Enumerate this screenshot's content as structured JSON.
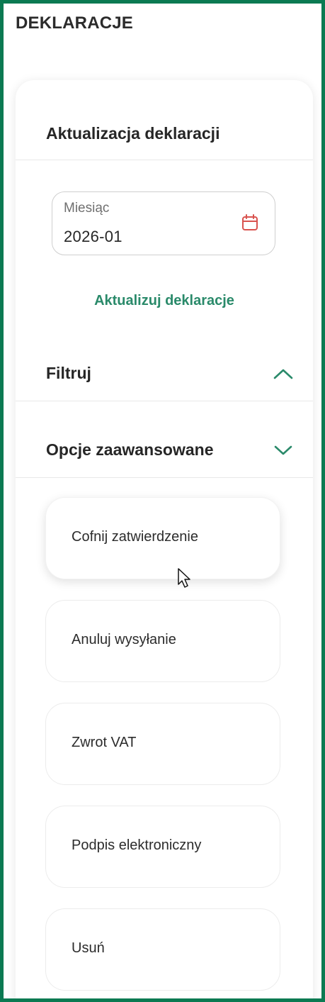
{
  "page": {
    "title": "DEKLARACJE"
  },
  "panel": {
    "title": "Aktualizacja deklaracji",
    "month_field": {
      "label": "Miesiąc",
      "value": "2026-01",
      "icon": "calendar-icon"
    },
    "update_link": "Aktualizuj deklaracje"
  },
  "sections": {
    "filter": {
      "title": "Filtruj",
      "icon": "chevron-up-icon",
      "expanded": true
    },
    "advanced": {
      "title": "Opcje zaawansowane",
      "icon": "chevron-down-icon",
      "expanded": false
    }
  },
  "options": [
    {
      "label": "Cofnij zatwierdzenie"
    },
    {
      "label": "Anuluj wysyłanie"
    },
    {
      "label": "Zwrot VAT"
    },
    {
      "label": "Podpis elektroniczny"
    },
    {
      "label": "Usuń"
    }
  ],
  "colors": {
    "border": "#0b7a52",
    "accent": "#2a8a6a",
    "calendar_icon": "#d9534f"
  }
}
